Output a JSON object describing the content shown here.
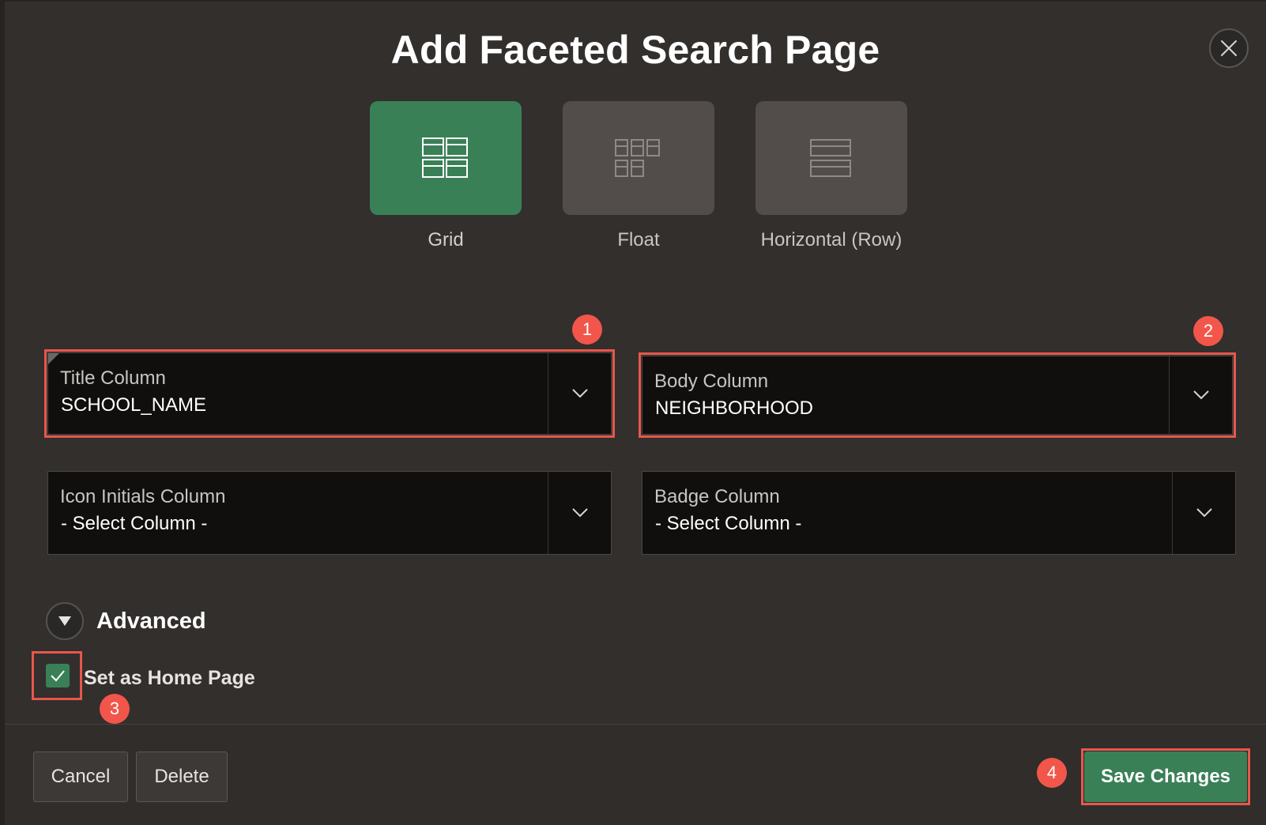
{
  "dialog": {
    "title": "Add Faceted Search Page",
    "close_icon": "close-icon"
  },
  "layouts": [
    {
      "label": "Grid",
      "icon": "grid-layout-icon",
      "selected": true
    },
    {
      "label": "Float",
      "icon": "float-layout-icon",
      "selected": false
    },
    {
      "label": "Horizontal (Row)",
      "icon": "horizontal-row-layout-icon",
      "selected": false
    }
  ],
  "fields": {
    "title_column": {
      "label": "Title Column",
      "value": "SCHOOL_NAME"
    },
    "body_column": {
      "label": "Body Column",
      "value": "NEIGHBORHOOD"
    },
    "icon_initials_column": {
      "label": "Icon Initials Column",
      "value": "- Select Column -"
    },
    "badge_column": {
      "label": "Badge Column",
      "value": "- Select Column -"
    }
  },
  "advanced": {
    "label": "Advanced"
  },
  "home_page": {
    "label": "Set as Home Page",
    "checked": true
  },
  "footer": {
    "cancel_label": "Cancel",
    "delete_label": "Delete",
    "save_label": "Save Changes"
  },
  "callouts": [
    "1",
    "2",
    "3",
    "4"
  ],
  "colors": {
    "accent": "#3a8057",
    "callout": "#f2564a",
    "highlight": "#e8574b",
    "dialog_bg": "#322f2d",
    "field_bg": "#100f0e"
  }
}
